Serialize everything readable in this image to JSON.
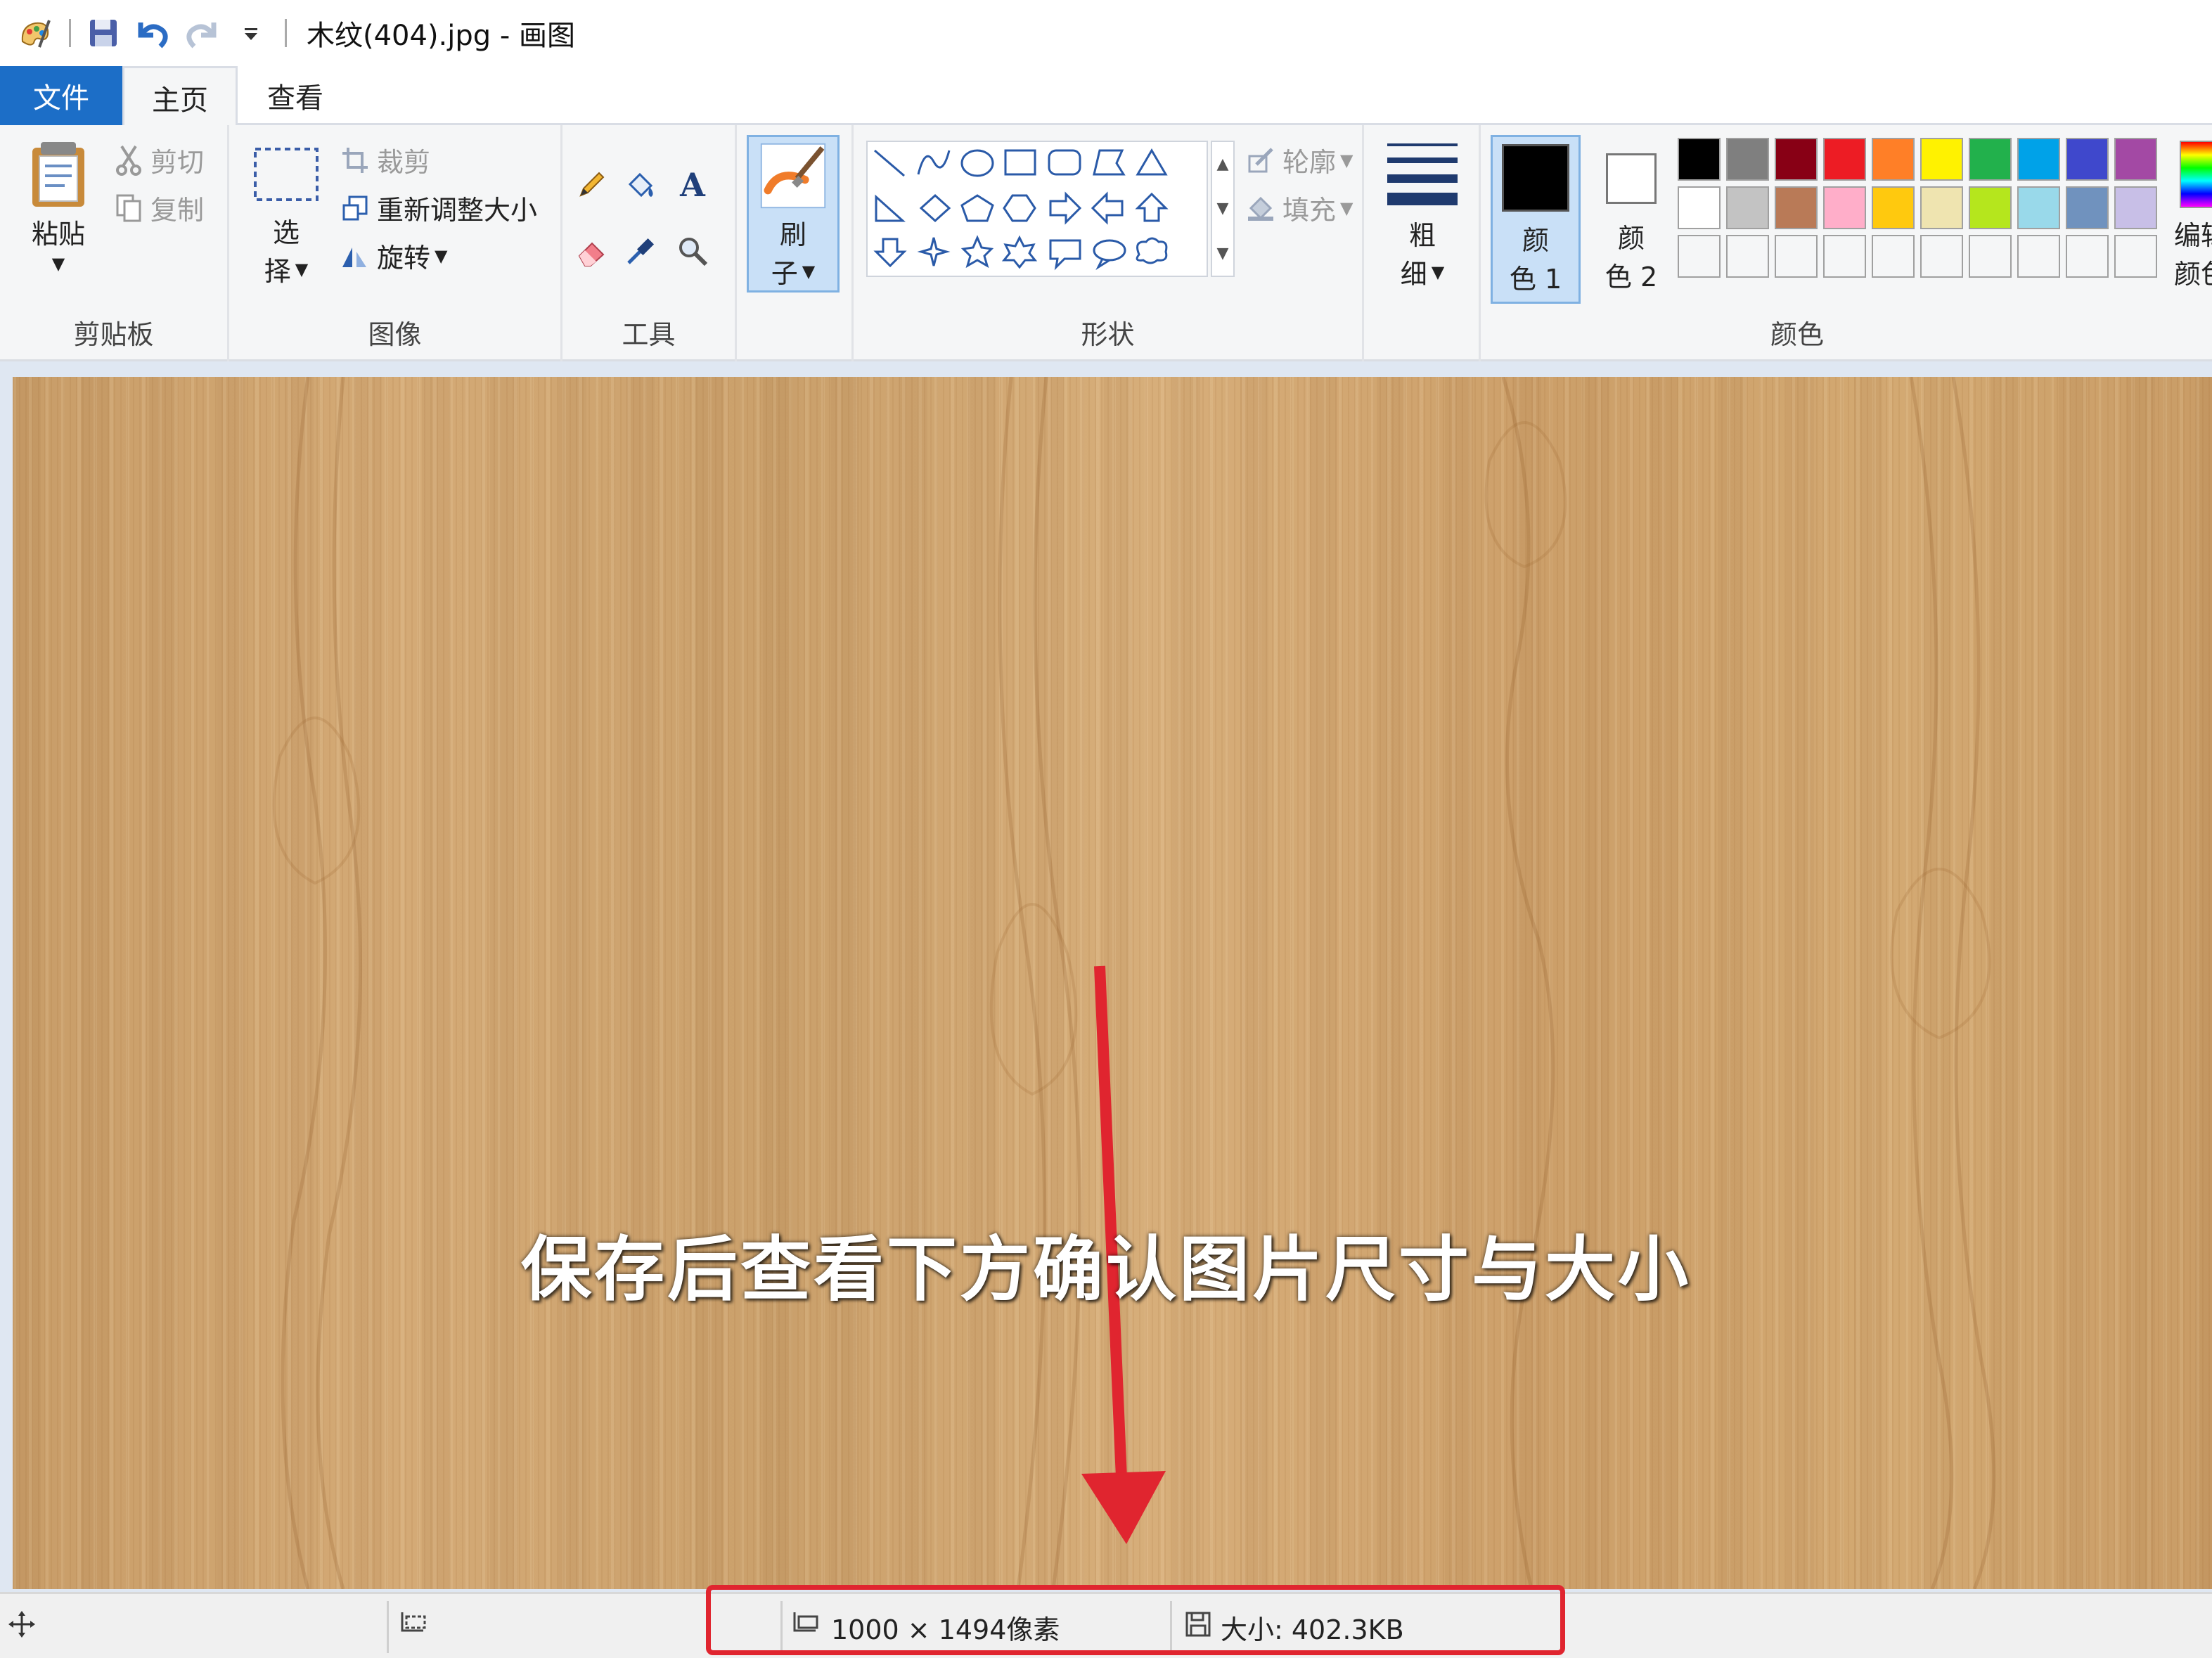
{
  "window": {
    "title": "木纹(404).jpg - 画图",
    "quick_access": [
      "paint-app-icon",
      "save-icon",
      "undo-icon",
      "redo-icon",
      "customize-dropdown-icon"
    ]
  },
  "tabs": [
    {
      "label": "文件",
      "active": false
    },
    {
      "label": "主页",
      "active": true
    },
    {
      "label": "查看",
      "active": false
    }
  ],
  "ribbon": {
    "clipboard": {
      "label": "剪贴板",
      "paste": "粘贴",
      "cut": "剪切",
      "copy": "复制"
    },
    "image": {
      "label": "图像",
      "select_top": "选",
      "select_bottom": "择",
      "crop": "裁剪",
      "resize": "重新调整大小",
      "rotate": "旋转"
    },
    "tools": {
      "label": "工具"
    },
    "brushes": {
      "label_top": "刷",
      "label_bottom": "子"
    },
    "shapes": {
      "label": "形状",
      "outline": "轮廓",
      "fill": "填充"
    },
    "size": {
      "label_top": "粗",
      "label_bottom": "细"
    },
    "colors": {
      "label": "颜色",
      "color1_top": "颜",
      "color1_bottom": "色 1",
      "color2_top": "颜",
      "color2_bottom": "色 2",
      "edit_top": "编辑",
      "edit_bottom": "颜色",
      "color1": "#000000",
      "color2": "#ffffff",
      "palette_row1": [
        "#000000",
        "#7f7f7f",
        "#880015",
        "#ed1c24",
        "#ff7f27",
        "#fff200",
        "#22b14c",
        "#00a2e8",
        "#3f48cc",
        "#a349a4"
      ],
      "palette_row2": [
        "#ffffff",
        "#c3c3c3",
        "#b97a57",
        "#ffaec9",
        "#ffc90e",
        "#efe4b0",
        "#b5e61d",
        "#99d9ea",
        "#7092be",
        "#c8bfe7"
      ]
    }
  },
  "canvas": {
    "annotation": "保存后查看下方确认图片尺寸与大小"
  },
  "statusbar": {
    "dimensions": "1000 × 1494像素",
    "size": "大小: 402.3KB"
  }
}
